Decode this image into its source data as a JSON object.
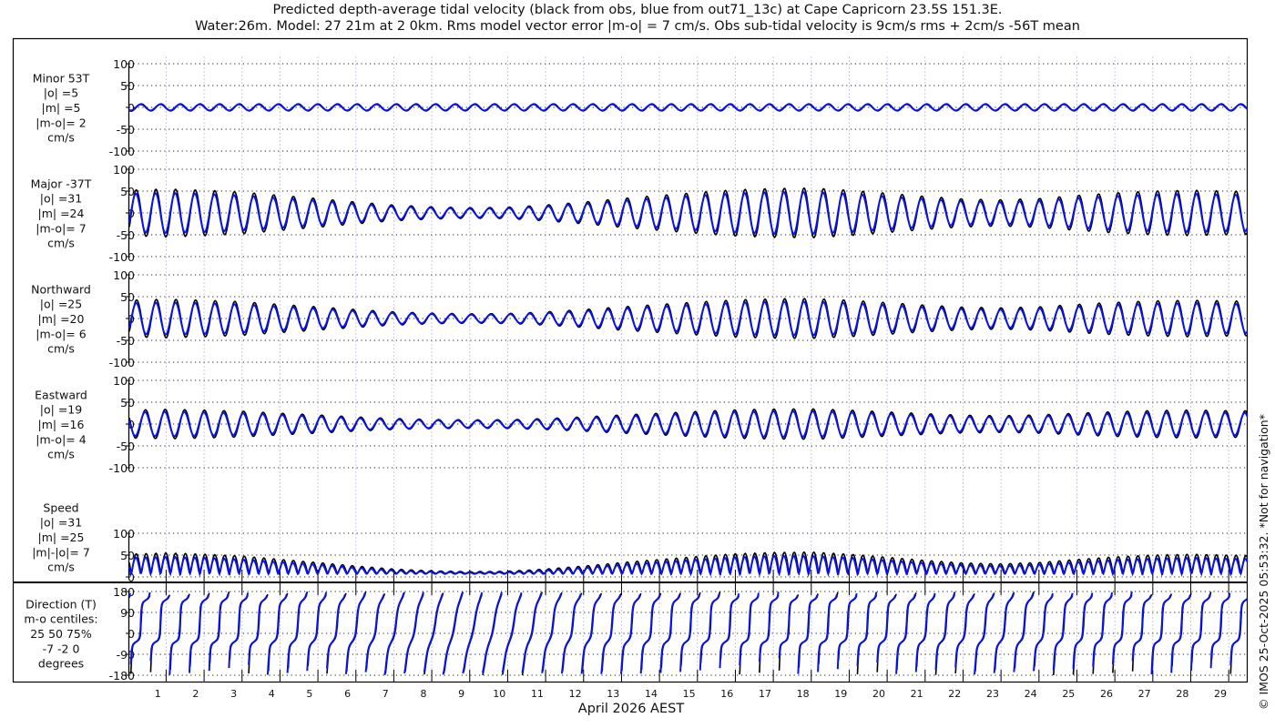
{
  "chart_data": {
    "type": "line",
    "title_line1": "Predicted depth-average tidal velocity (black from obs, blue from out71_13c) at Cape Capricorn 23.5S 151.3E.",
    "title_line2": "Water:26m. Model: 27 21m at 2 0km. Rms model vector error |m-o| = 7 cm/s. Obs sub-tidal velocity is 9cm/s rms + 2cm/s -56T mean",
    "xlabel": "April 2026 AEST",
    "x_tick_labels": [
      "1",
      "2",
      "3",
      "4",
      "5",
      "6",
      "7",
      "8",
      "9",
      "10",
      "11",
      "12",
      "13",
      "14",
      "15",
      "16",
      "17",
      "18",
      "19",
      "20",
      "21",
      "22",
      "23",
      "24",
      "25",
      "26",
      "27",
      "28",
      "29"
    ],
    "xlim_days": [
      -0.97,
      28.5
    ],
    "tidal_period_days": 0.5175,
    "major_direction_T": -37,
    "envelope_days": [
      -1,
      0,
      1,
      2,
      3,
      4,
      5,
      6,
      7,
      8,
      9,
      10,
      11,
      12,
      13,
      14,
      15,
      16,
      17,
      18,
      19,
      20,
      21,
      22,
      23,
      24,
      25,
      26,
      27,
      28,
      29
    ],
    "obs_major_amplitude": [
      52,
      55,
      52,
      48,
      40,
      33,
      25,
      18,
      14,
      12,
      13,
      18,
      25,
      33,
      40,
      47,
      53,
      56,
      57,
      52,
      45,
      38,
      32,
      30,
      33,
      40,
      46,
      50,
      52,
      50,
      48
    ],
    "model_major_amplitude": [
      44,
      46,
      44,
      40,
      34,
      28,
      21,
      15,
      12,
      10,
      11,
      15,
      21,
      28,
      34,
      40,
      45,
      48,
      48,
      44,
      38,
      32,
      27,
      25,
      28,
      34,
      39,
      42,
      44,
      42,
      41
    ],
    "obs_minor_amplitude": 8,
    "model_minor_amplitude": 7,
    "series_colors": {
      "obs": "#000000",
      "model": "#0a14e6"
    },
    "panels": [
      {
        "key": "minor",
        "labels": [
          "Minor 53T",
          "|o| =5",
          "|m| =5",
          "|m-o|= 2",
          "cm/s"
        ],
        "ylim": [
          -100,
          100
        ],
        "yticks": [
          "100",
          "50",
          "0",
          "-50",
          "-100"
        ]
      },
      {
        "key": "major",
        "labels": [
          "Major -37T",
          "|o| =31",
          "|m| =24",
          "|m-o|= 7",
          "cm/s"
        ],
        "ylim": [
          -100,
          100
        ],
        "yticks": [
          "100",
          "50",
          "0",
          "-50",
          "-100"
        ]
      },
      {
        "key": "north",
        "labels": [
          "Northward",
          "|o| =25",
          "|m| =20",
          "|m-o|= 6",
          "cm/s"
        ],
        "ylim": [
          -100,
          100
        ],
        "yticks": [
          "100",
          "50",
          "0",
          "-50",
          "-100"
        ]
      },
      {
        "key": "east",
        "labels": [
          "Eastward",
          "|o| =19",
          "|m| =16",
          "|m-o|= 4",
          "cm/s"
        ],
        "ylim": [
          -100,
          100
        ],
        "yticks": [
          "100",
          "50",
          "0",
          "-50",
          "-100"
        ]
      },
      {
        "key": "speed",
        "labels": [
          "Speed",
          "|o| =31",
          "|m| =25",
          "|m|-|o|= 7",
          "cm/s"
        ],
        "ylim": [
          0,
          100
        ],
        "yticks": [
          "100",
          "50",
          "0"
        ]
      },
      {
        "key": "direction",
        "labels": [
          "Direction (T)",
          "m-o centiles:",
          "25  50  75%",
          "-7 -2  0",
          "degrees"
        ],
        "ylim": [
          -180,
          180
        ],
        "yticks": [
          "180",
          "90",
          "0",
          "-90",
          "-180"
        ]
      }
    ],
    "credit": "© IMOS 25-Oct-2025 05:53:32. *Not for navigation*"
  }
}
